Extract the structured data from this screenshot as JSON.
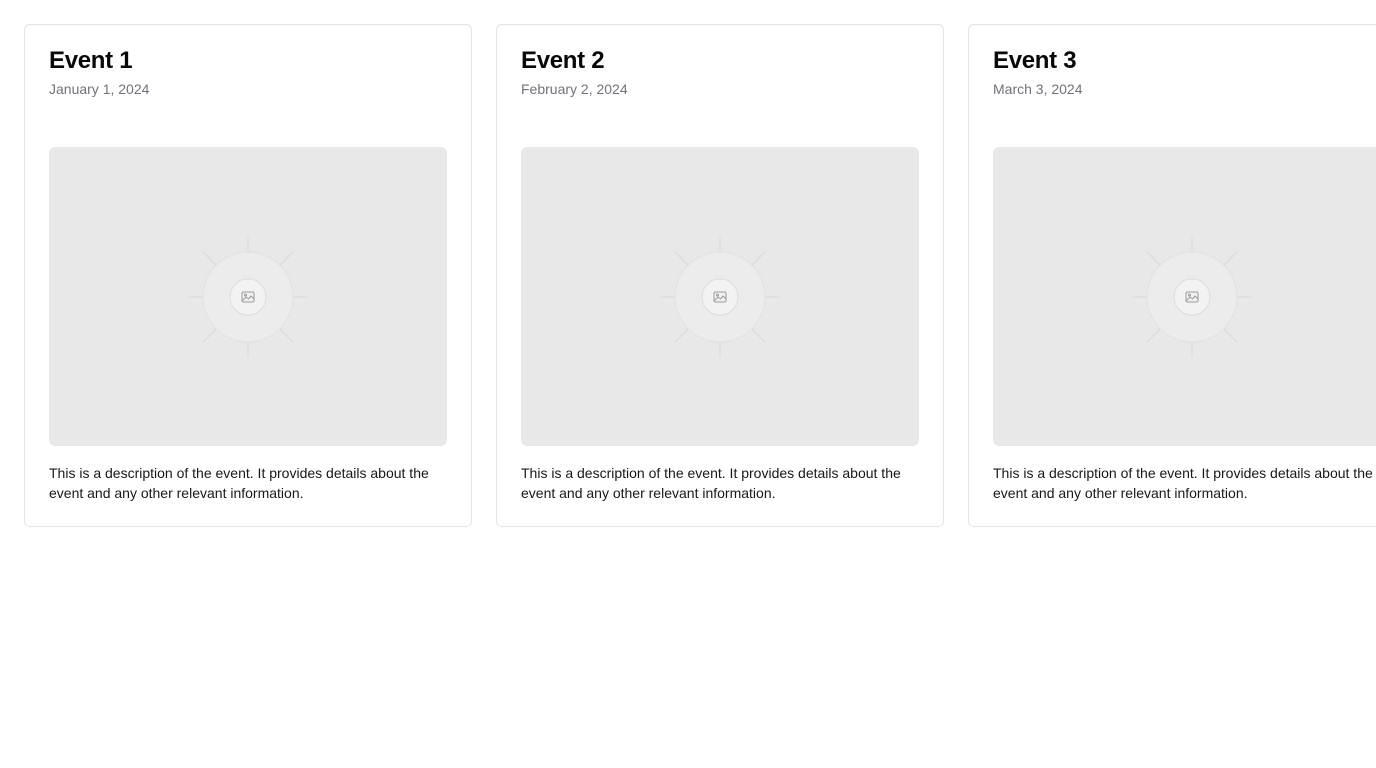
{
  "events": [
    {
      "title": "Event 1",
      "date": "January 1, 2024",
      "image_icon": "image-placeholder-icon",
      "description": "This is a description of the event. It provides details about the event and any other relevant information."
    },
    {
      "title": "Event 2",
      "date": "February 2, 2024",
      "image_icon": "image-placeholder-icon",
      "description": "This is a description of the event. It provides details about the event and any other relevant information."
    },
    {
      "title": "Event 3",
      "date": "March 3, 2024",
      "image_icon": "image-placeholder-icon",
      "description": "This is a description of the event. It provides details about the event and any other relevant information."
    }
  ],
  "colors": {
    "border": "#e4e4e7",
    "title": "#09090b",
    "date": "#71717a",
    "placeholder_bg": "#e8e8e8"
  }
}
